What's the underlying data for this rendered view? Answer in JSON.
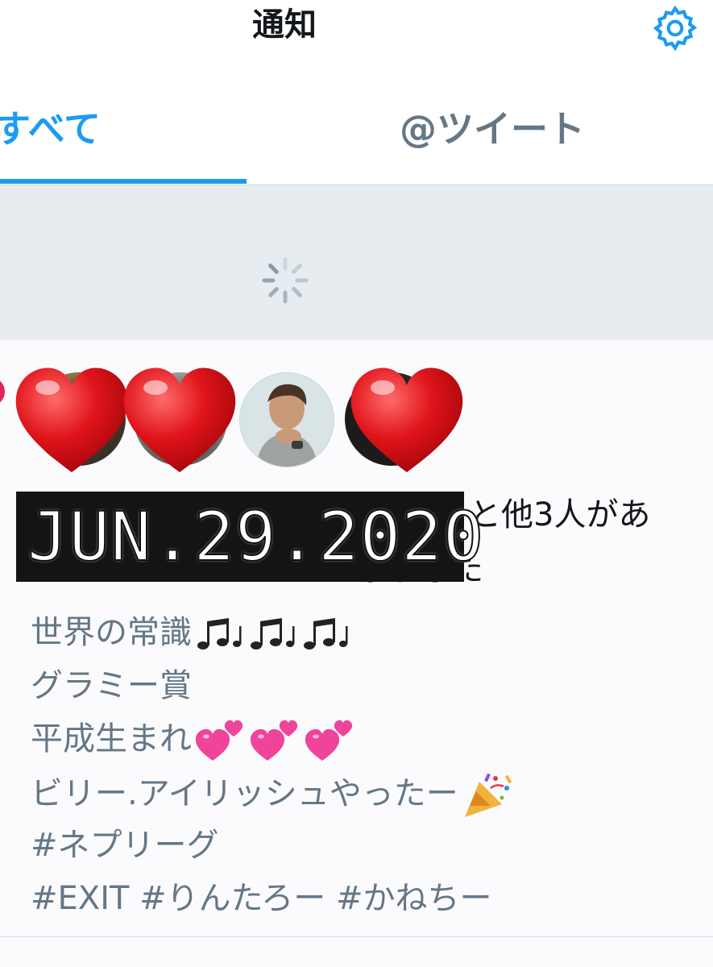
{
  "header": {
    "title": "通知",
    "settings_icon": "gear-icon",
    "accent": "#1d9bf0"
  },
  "tabs": [
    {
      "label": "すべて",
      "selected": true
    },
    {
      "label": "@ツイート",
      "selected": false
    }
  ],
  "loading": {
    "icon": "spinner-icon"
  },
  "notification": {
    "icon": "heart-icon",
    "text_tail": "と他3人があ",
    "text_line2": "しました",
    "overlay_date": "JUN.29.2020",
    "tweet_lines": [
      "世界の常識",
      "グラミー賞",
      "平成生まれ",
      "ビリー.アイリッシュやったー",
      "#ネプリーグ",
      "#EXIT #りんたろー #かねちー"
    ]
  }
}
